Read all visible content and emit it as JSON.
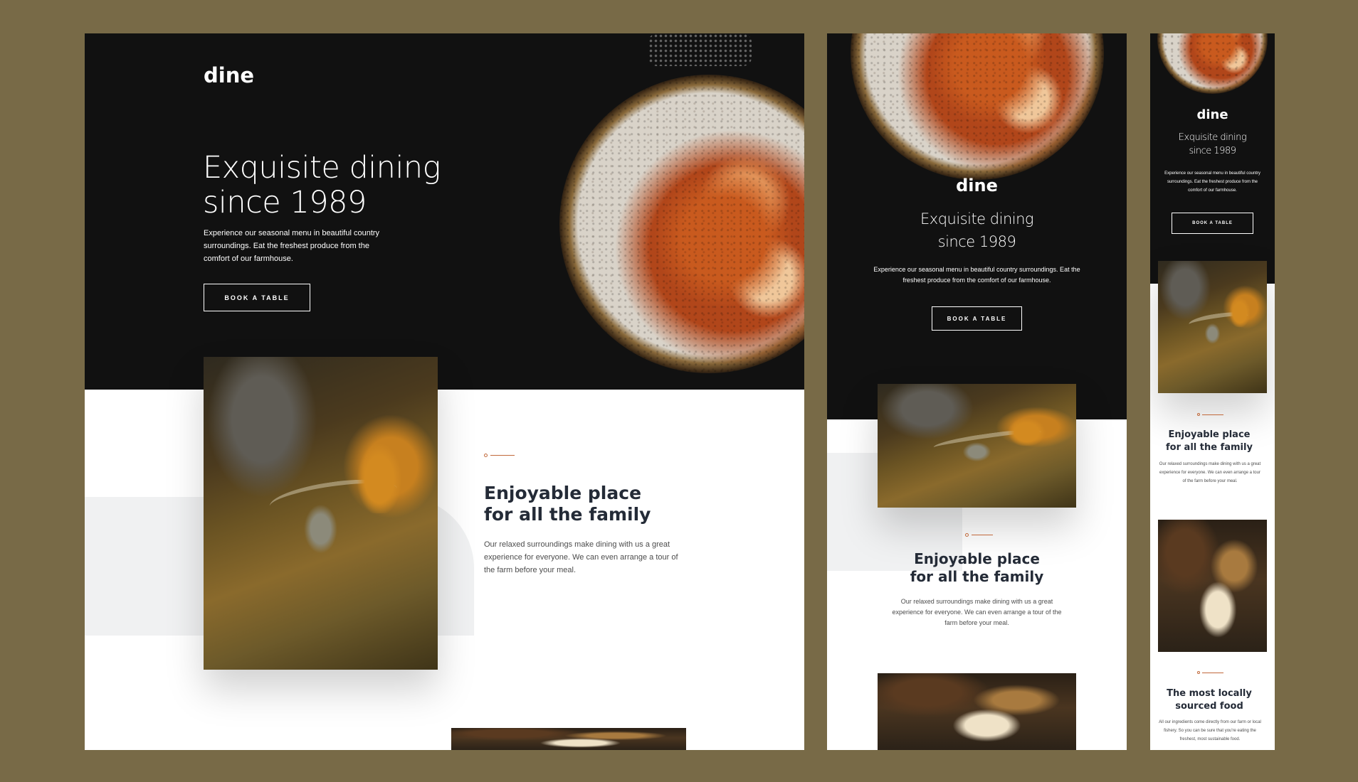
{
  "brand": {
    "logo": "dine"
  },
  "hero": {
    "title_line1": "Exquisite dining",
    "title_line2": "since 1989",
    "description": "Experience our seasonal menu in beautiful country surroundings. Eat the freshest produce from the comfort of our farmhouse.",
    "cta": "BOOK A TABLE"
  },
  "features": [
    {
      "title_line1": "Enjoyable place",
      "title_line2": "for all the family",
      "description": "Our relaxed surroundings make dining with us a great experience for everyone. We can even arrange a tour of the farm before your meal."
    },
    {
      "title_line1": "The most locally",
      "title_line2": "sourced food",
      "description": "All our ingredients come directly from our farm or local fishery. So you can be sure that you're eating the freshest, most sustainable food."
    }
  ],
  "colors": {
    "backdrop": "#786a47",
    "dark": "#111111",
    "accent": "#c1693b",
    "heading": "#242b37"
  }
}
